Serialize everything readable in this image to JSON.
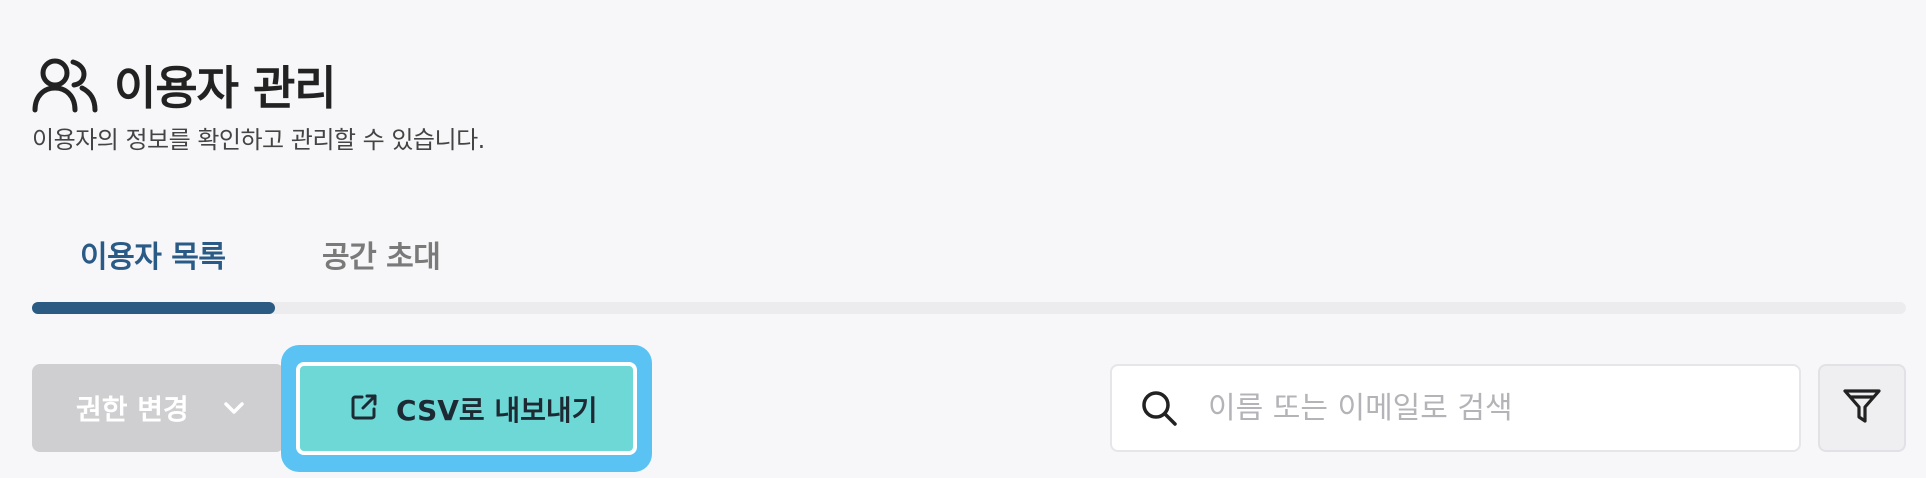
{
  "header": {
    "icon": "users-icon",
    "title": "이용자 관리",
    "subtitle": "이용자의 정보를 확인하고 관리할 수 있습니다."
  },
  "tabs": [
    {
      "label": "이용자 목록",
      "active": true
    },
    {
      "label": "공간 초대",
      "active": false
    }
  ],
  "toolbar": {
    "role_change_label": "권한 변경",
    "role_change_icon": "chevron-down-icon",
    "role_change_enabled": false,
    "export_label": "CSV로 내보내기",
    "export_icon": "external-link-icon",
    "search_placeholder": "이름 또는 이메일로 검색",
    "search_icon": "search-icon",
    "filter_icon": "filter-icon"
  },
  "colors": {
    "background": "#f7f7f9",
    "tab_active": "#2a5a86",
    "tab_indicator": "#2b5a82",
    "export_button": "#6dd8d6",
    "focus_ring": "#5bc3f3",
    "disabled_button": "#cfcfd1"
  }
}
